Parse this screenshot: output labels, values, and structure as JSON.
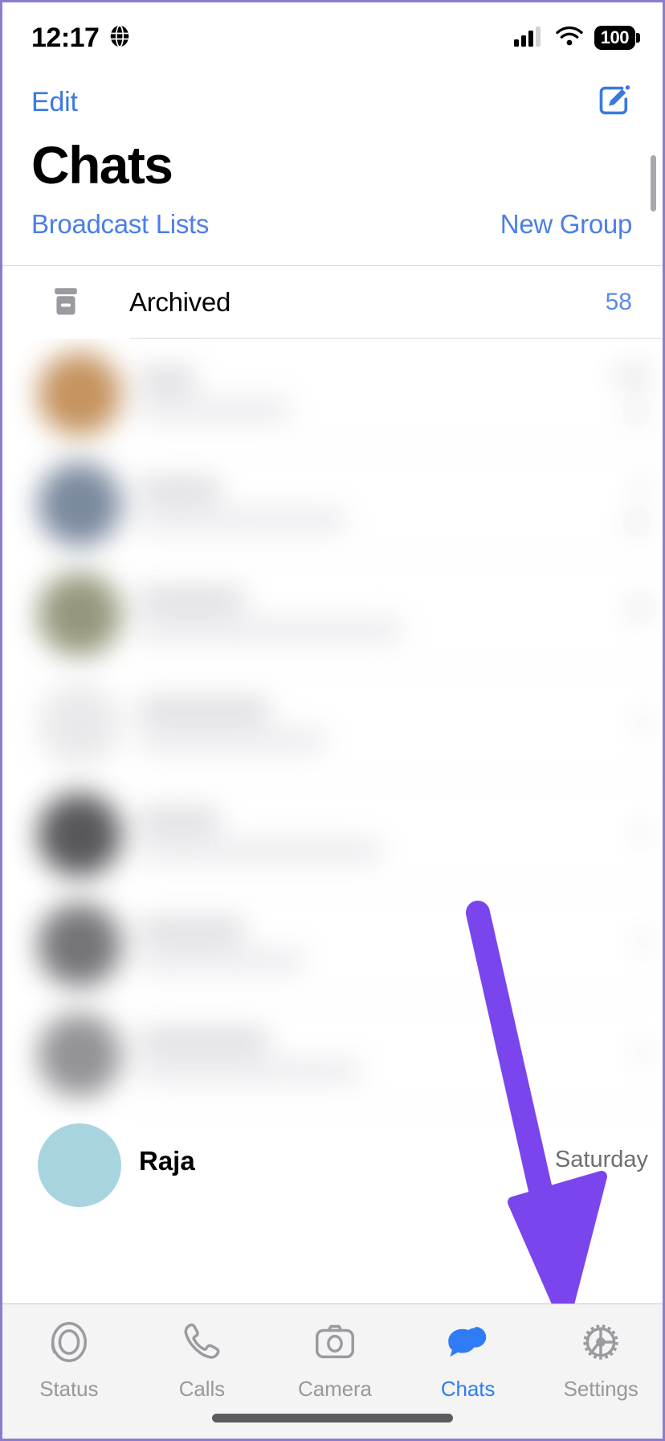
{
  "status_bar": {
    "time": "12:17",
    "location_icon": "globe-icon",
    "signal_icon": "cellular-signal-icon",
    "wifi_icon": "wifi-icon",
    "battery_level": "100"
  },
  "nav": {
    "edit_label": "Edit",
    "compose_icon": "compose-new-chat-icon",
    "title": "Chats",
    "broadcast_label": "Broadcast Lists",
    "new_group_label": "New Group"
  },
  "archived": {
    "icon": "archive-box-icon",
    "label": "Archived",
    "count": "58"
  },
  "chat_list": {
    "rows": [
      {
        "name": "",
        "snippet": "",
        "time": "AM",
        "avatar_color": "#c08a52",
        "chevron": "▶",
        "blurred": true
      },
      {
        "name": "",
        "snippet": "",
        "time": "y",
        "avatar_color": "#6f7f96",
        "chevron": "▶",
        "blurred": true
      },
      {
        "name": "",
        "snippet": "",
        "time": "M",
        "avatar_color": "#8d8f72",
        "chevron": "",
        "blurred": true
      },
      {
        "name": "",
        "snippet": "",
        "time": "y",
        "avatar_color": "#e8e8ea",
        "chevron": "",
        "blurred": true
      },
      {
        "name": "",
        "snippet": "",
        "time": "y",
        "avatar_color": "#4a4a4e",
        "chevron": "",
        "blurred": true
      },
      {
        "name": "",
        "snippet": "",
        "time": "y",
        "avatar_color": "#6a6a6e",
        "chevron": "",
        "blurred": true
      },
      {
        "name": "",
        "snippet": "",
        "time": "y",
        "avatar_color": "#8a8a8e",
        "chevron": "",
        "blurred": true
      }
    ],
    "last_visible_row": {
      "name": "Raja",
      "time": "Saturday",
      "avatar_color": "#a8d4e0"
    }
  },
  "annotation": {
    "arrow_color": "#7B45EE",
    "points_to": "settings-tab"
  },
  "tab_bar": {
    "items": [
      {
        "label": "Status",
        "icon": "status-rings-icon",
        "active": false
      },
      {
        "label": "Calls",
        "icon": "phone-handset-icon",
        "active": false
      },
      {
        "label": "Camera",
        "icon": "camera-icon",
        "active": false
      },
      {
        "label": "Chats",
        "icon": "chat-bubbles-icon",
        "active": true
      },
      {
        "label": "Settings",
        "icon": "gear-icon",
        "active": false
      }
    ],
    "active_color": "#2F7CF6",
    "inactive_color": "#98989d"
  }
}
